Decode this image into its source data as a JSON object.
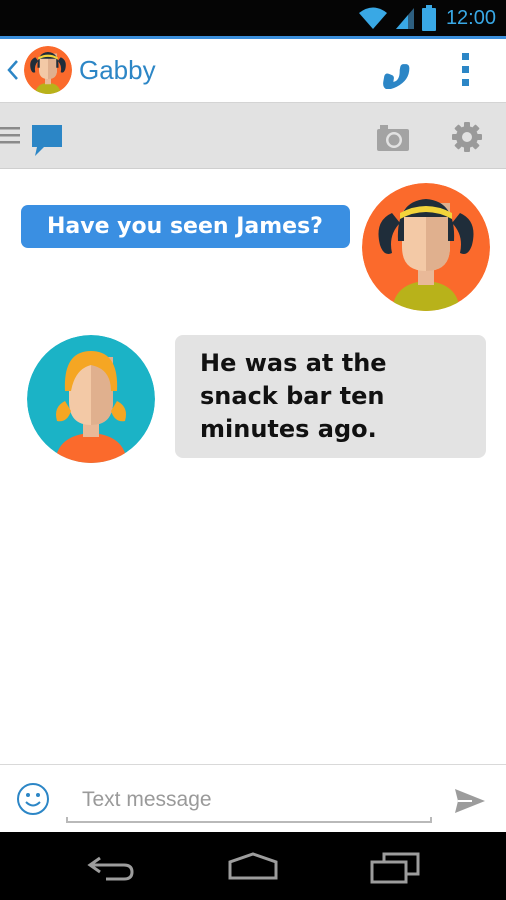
{
  "status_bar": {
    "time": "12:00",
    "icons": [
      "wifi-icon",
      "signal-icon",
      "battery-icon"
    ],
    "color": "#39a8e5"
  },
  "header": {
    "contact_name": "Gabby",
    "icons": [
      "back-icon",
      "avatar",
      "phone-icon",
      "overflow-menu-icon"
    ],
    "accent_color": "#2c86c6"
  },
  "toolbar": {
    "icons": [
      "menu-icon",
      "chat-bubble-icon",
      "camera-icon",
      "gear-icon"
    ]
  },
  "messages": [
    {
      "direction": "outgoing",
      "text": "Have you seen James?",
      "bubble_color": "#3a8fe2",
      "avatar": "girl-pigtails-avatar"
    },
    {
      "direction": "incoming",
      "text": "He was at the snack bar ten minutes ago.",
      "bubble_color": "#e3e3e3",
      "avatar": "girl-ponytail-avatar"
    }
  ],
  "compose": {
    "placeholder": "Text message",
    "value": "",
    "icons": [
      "emoji-icon",
      "send-icon"
    ]
  },
  "nav_bar": {
    "icons": [
      "back-icon",
      "home-icon",
      "recent-apps-icon"
    ]
  }
}
